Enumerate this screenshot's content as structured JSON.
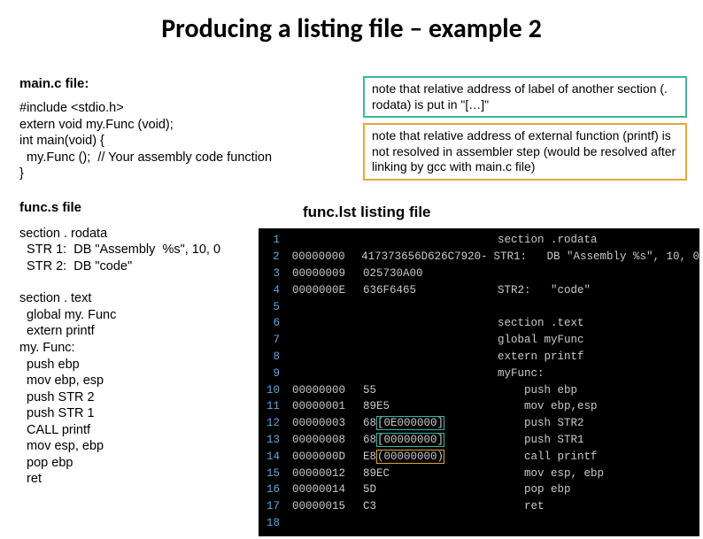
{
  "title": "Producing a listing file – example 2",
  "left": {
    "mainc_label": "main.c file:",
    "mainc_code": "#include <stdio.h>\nextern void my.Func (void);\nint main(void) {\n  my.Func ();  // Your assembly code function\n}",
    "funcs_label": "func.s file",
    "funcs_rodata": "section . rodata\n  STR 1:  DB \"Assembly  %s\", 10, 0\n  STR 2:  DB \"code\"",
    "funcs_text": "section . text\n  global my. Func\n  extern printf\nmy. Func:\n  push ebp\n  mov ebp, esp\n  push STR 2\n  push STR 1\n  CALL printf\n  mov esp, ebp\n  pop ebp\n  ret"
  },
  "notes": {
    "teal": "note that relative address of label of another section (. rodata) is put in \"[…]\"",
    "orange": "note that relative address of external function (printf) is not resolved in assembler step (would be resolved after linking by gcc with main.c file)"
  },
  "listing_label": "func.lst listing file",
  "listing": {
    "rows": [
      {
        "n": "1",
        "addr": "",
        "hex": "",
        "asm": "section .rodata"
      },
      {
        "n": "2",
        "addr": "00000000",
        "hex": "417373656D626C7920-",
        "asm": "STR1:   DB \"Assembly %s\", 10, 0"
      },
      {
        "n": "3",
        "addr": "00000009",
        "hex": "025730A00",
        "asm": ""
      },
      {
        "n": "4",
        "addr": "0000000E",
        "hex": "636F6465",
        "asm": "STR2:   \"code\""
      },
      {
        "n": "5",
        "addr": "",
        "hex": "",
        "asm": ""
      },
      {
        "n": "6",
        "addr": "",
        "hex": "",
        "asm": "section .text"
      },
      {
        "n": "7",
        "addr": "",
        "hex": "",
        "asm": "global myFunc"
      },
      {
        "n": "8",
        "addr": "",
        "hex": "",
        "asm": "extern printf"
      },
      {
        "n": "9",
        "addr": "",
        "hex": "",
        "asm_pre": "myFunc:",
        "asm": ""
      },
      {
        "n": "10",
        "addr": "00000000",
        "hex": "55",
        "asm": "    push ebp"
      },
      {
        "n": "11",
        "addr": "00000001",
        "hex": "89E5",
        "asm": "    mov ebp,esp"
      },
      {
        "n": "12",
        "addr": "00000003",
        "hex_pre": "68",
        "hex_box": "[0E000000]",
        "box": "teal",
        "asm": "    push STR2"
      },
      {
        "n": "13",
        "addr": "00000008",
        "hex_pre": "68",
        "hex_box": "[00000000]",
        "box": "teal",
        "asm": "    push STR1"
      },
      {
        "n": "14",
        "addr": "0000000D",
        "hex_pre": "E8",
        "hex_box": "(00000000)",
        "box": "orange",
        "asm": "    call printf"
      },
      {
        "n": "15",
        "addr": "00000012",
        "hex": "89EC",
        "asm": "    mov esp, ebp"
      },
      {
        "n": "16",
        "addr": "00000014",
        "hex": "5D",
        "asm": "    pop ebp"
      },
      {
        "n": "17",
        "addr": "00000015",
        "hex": "C3",
        "asm": "    ret"
      },
      {
        "n": "18",
        "addr": "",
        "hex": "",
        "asm": ""
      }
    ]
  }
}
